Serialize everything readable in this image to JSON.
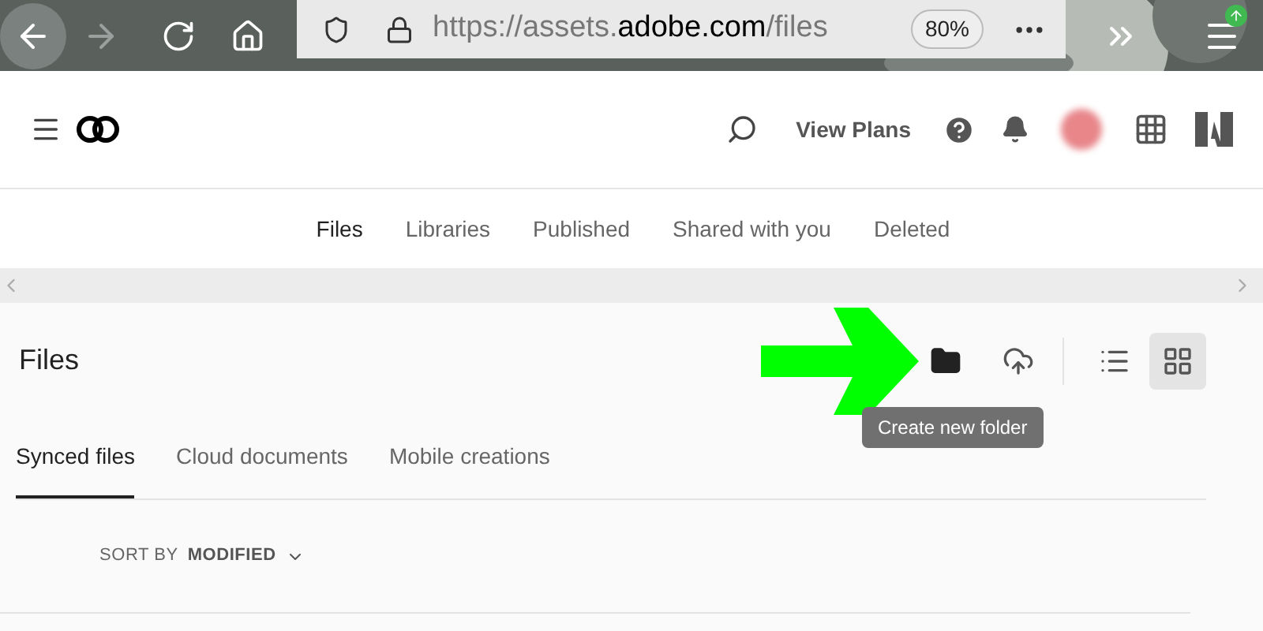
{
  "browser": {
    "url_prefix": "https://assets.",
    "url_domain": "adobe.com",
    "url_suffix": "/files",
    "zoom": "80%"
  },
  "header": {
    "link": "View Plans"
  },
  "nav_tabs": [
    {
      "label": "Files",
      "selected": true
    },
    {
      "label": "Libraries",
      "selected": false
    },
    {
      "label": "Published",
      "selected": false
    },
    {
      "label": "Shared with you",
      "selected": false
    },
    {
      "label": "Deleted",
      "selected": false
    }
  ],
  "page_title": "Files",
  "tooltip": "Create new folder",
  "views": [
    {
      "kind": "list",
      "selected": false
    },
    {
      "kind": "grid",
      "selected": true
    }
  ],
  "sub_tabs": [
    {
      "label": "Synced files",
      "selected": true
    },
    {
      "label": "Cloud documents",
      "selected": false
    },
    {
      "label": "Mobile creations",
      "selected": false
    }
  ],
  "sort": {
    "label": "SORT BY",
    "value": "MODIFIED"
  }
}
